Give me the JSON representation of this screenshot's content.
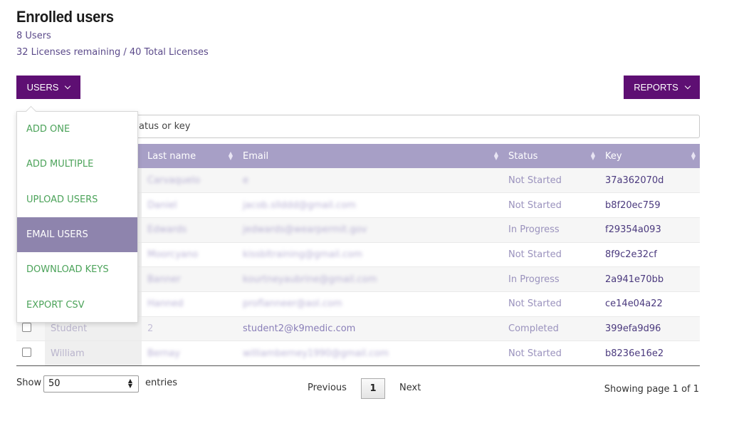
{
  "header": {
    "title": "Enrolled users",
    "user_count": "8 Users",
    "licenses": "32 Licenses remaining / 40 Total Licenses"
  },
  "toolbar": {
    "users_label": "USERS",
    "reports_label": "REPORTS"
  },
  "search": {
    "visible_placeholder_fragment": "atus or key"
  },
  "dropdown": {
    "items": [
      {
        "label": "ADD ONE"
      },
      {
        "label": "ADD MULTIPLE"
      },
      {
        "label": "UPLOAD USERS"
      },
      {
        "label": "EMAIL USERS",
        "active": true
      },
      {
        "label": "DOWNLOAD KEYS"
      },
      {
        "label": "EXPORT CSV"
      }
    ]
  },
  "table": {
    "headers": [
      "Last name",
      "Email",
      "Status",
      "Key"
    ],
    "rows": [
      {
        "first": "",
        "last": "Carvaquelo",
        "email": "e",
        "status": "Not Started",
        "key": "37a362070d",
        "blurred": true
      },
      {
        "first": "",
        "last": "Daniel",
        "email": "jacob.sllddd@gmail.com",
        "status": "Not Started",
        "key": "b8f20ec759",
        "blurred": true
      },
      {
        "first": "",
        "last": "Edwards",
        "email": "jedwards@wearpermit.gov",
        "status": "In Progress",
        "key": "f29354a093",
        "blurred": true
      },
      {
        "first": "",
        "last": "Moorcyano",
        "email": "kissbltraining@gmail.com",
        "status": "Not Started",
        "key": "8f9c2e32cf",
        "blurred": true
      },
      {
        "first": "",
        "last": "Banner",
        "email": "kourtneyaubrine@gmail.com",
        "status": "In Progress",
        "key": "2a941e70bb",
        "blurred": true
      },
      {
        "first": "",
        "last": "Hanned",
        "email": "proflanneer@aol.com",
        "status": "Not Started",
        "key": "ce14e04a22",
        "blurred": true
      },
      {
        "first": "Student",
        "last": "2",
        "email": "student2@k9medic.com",
        "status": "Completed",
        "key": "399efa9d96",
        "blurred": false
      },
      {
        "first": "William",
        "last": "Bernay",
        "email": "williamberney1990@gmail.com",
        "status": "Not Started",
        "key": "b8236e16e2",
        "blurred": true
      }
    ]
  },
  "footer": {
    "show_label": "Show",
    "entries_value": "50",
    "entries_label": "entries",
    "previous": "Previous",
    "page": "1",
    "next": "Next",
    "page_info": "Showing page 1 of 1"
  }
}
